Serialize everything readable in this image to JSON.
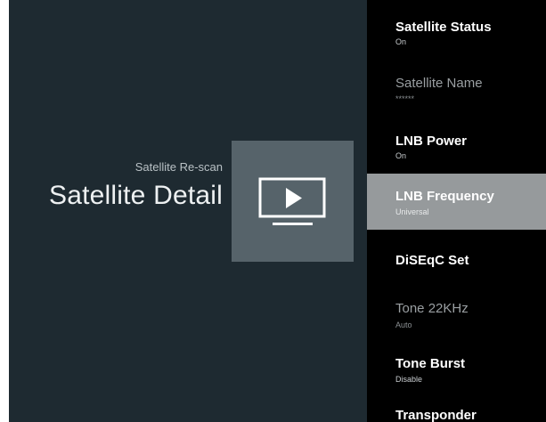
{
  "left": {
    "subtitle": "Satellite Re-scan",
    "title": "Satellite Detail",
    "tile_icon": "tv-play-icon"
  },
  "menu": {
    "items": [
      {
        "label": "Satellite Status",
        "value": "On",
        "state": "normal"
      },
      {
        "label": "Satellite Name",
        "value": "******",
        "state": "dim"
      },
      {
        "label": "LNB Power",
        "value": "On",
        "state": "normal"
      },
      {
        "label": "LNB Frequency",
        "value": "Universal",
        "state": "selected"
      },
      {
        "label": "DiSEqC Set",
        "value": "",
        "state": "normal"
      },
      {
        "label": "Tone 22KHz",
        "value": "Auto",
        "state": "dim"
      },
      {
        "label": "Tone Burst",
        "value": "Disable",
        "state": "normal"
      },
      {
        "label": "Transponder",
        "value": "",
        "state": "normal"
      }
    ]
  },
  "colors": {
    "left_background": "#1e2a31",
    "tile_background": "#56636a",
    "selected_background": "#969a9c",
    "menu_background": "#000000"
  }
}
